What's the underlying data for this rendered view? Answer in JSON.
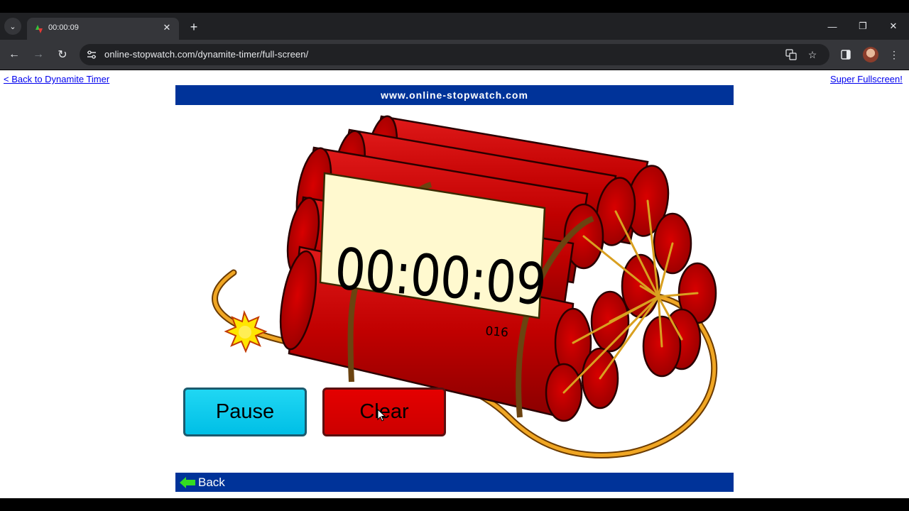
{
  "browser": {
    "tab_title": "00:00:09",
    "url": "online-stopwatch.com/dynamite-timer/full-screen/",
    "new_tab_symbol": "+",
    "tab_close_symbol": "✕",
    "window_controls": {
      "minimize": "—",
      "restore": "❐",
      "close": "✕"
    }
  },
  "page": {
    "back_link": "< Back to Dynamite Timer",
    "fullscreen_link": "Super Fullscreen!",
    "banner": "www.online-stopwatch.com",
    "timer": {
      "time": "00:00:09",
      "milliseconds": "016"
    },
    "buttons": {
      "pause": "Pause",
      "clear": "Clear"
    },
    "footer_back": "Back",
    "colors": {
      "banner_blue": "#003399",
      "dynamite_red": "#cc0000",
      "pause_cyan": "#1ccfee",
      "fuse_orange": "#e8a020",
      "spark_yellow": "#ffee00"
    }
  }
}
